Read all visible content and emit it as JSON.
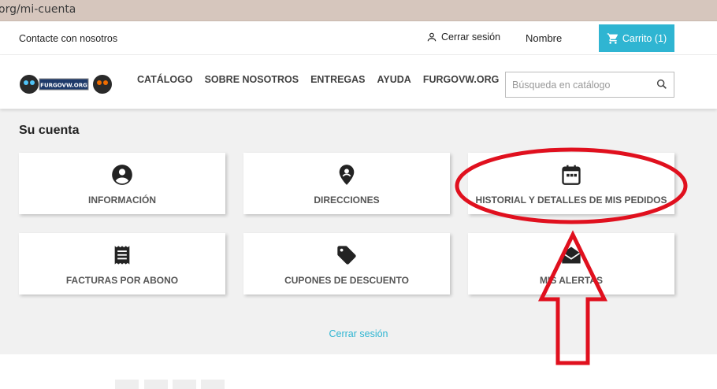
{
  "browser": {
    "url": "org/mi-cuenta"
  },
  "topbar": {
    "contact": "Contacte con nosotros",
    "logout": "Cerrar sesión",
    "user": "Nombre",
    "cart": "Carrito (1)"
  },
  "header": {
    "logo_text": "FURGOVW.ORG",
    "nav": [
      "CATÁLOGO",
      "SOBRE NOSOTROS",
      "ENTREGAS",
      "AYUDA",
      "FURGOVW.ORG"
    ],
    "search_placeholder": "Búsqueda en catálogo"
  },
  "account": {
    "title": "Su cuenta",
    "cards": [
      {
        "label": "INFORMACIÓN",
        "icon": "account-circle-icon"
      },
      {
        "label": "DIRECCIONES",
        "icon": "location-pin-icon"
      },
      {
        "label": "HISTORIAL Y DETALLES DE MIS PEDIDOS",
        "icon": "calendar-icon"
      },
      {
        "label": "FACTURAS POR ABONO",
        "icon": "receipt-icon"
      },
      {
        "label": "CUPONES DE DESCUENTO",
        "icon": "tag-icon"
      },
      {
        "label": "MIS ALERTAS",
        "icon": "mail-icon"
      }
    ],
    "logout": "Cerrar sesión"
  },
  "annotation_colors": {
    "red": "#e0101e",
    "accent": "#2fb5d2"
  }
}
